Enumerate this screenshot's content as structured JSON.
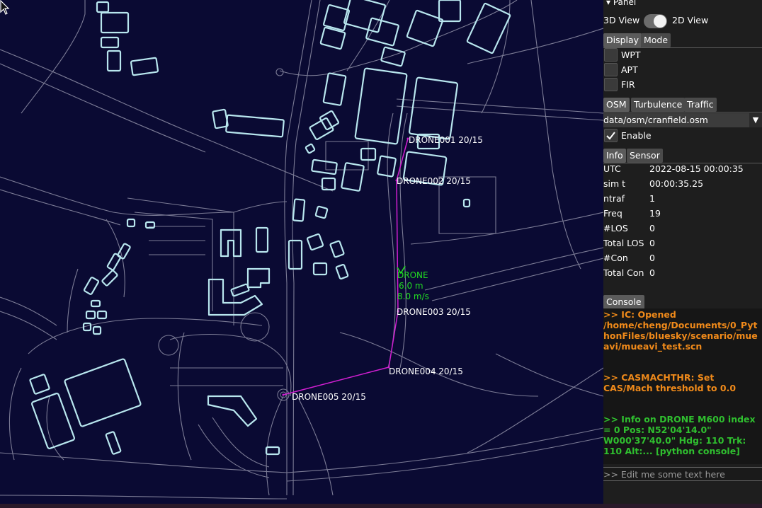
{
  "map": {
    "waypoints": [
      {
        "label": "DRONE001 20/15"
      },
      {
        "label": "DRONE002 20/15"
      },
      {
        "label": "DRONE003 20/15"
      },
      {
        "label": "DRONE004 20/15"
      },
      {
        "label": "DRONE005 20/15"
      }
    ],
    "aircraft": {
      "id": "DRONE",
      "altitude": "6.0 m",
      "speed": "8.0 m/s"
    },
    "colors": {
      "background": "#0a0a33",
      "roads": "#7c7c96",
      "buildings": "#b8e6ee",
      "route": "#d21fd2",
      "aircraft": "#22dd22"
    }
  },
  "panel": {
    "title": "▾ Panel",
    "view_3d_label": "3D View",
    "view_2d_label": "2D View",
    "display_tabs": [
      "Display",
      "Mode"
    ],
    "display_checkboxes": [
      {
        "label": "WPT",
        "checked": false
      },
      {
        "label": "APT",
        "checked": false
      },
      {
        "label": "FIR",
        "checked": false
      }
    ],
    "layer_tabs": [
      "OSM",
      "Turbulence",
      "Traffic"
    ],
    "osm_file": "data/osm/cranfield.osm",
    "enable_label": "Enable",
    "enable_checked": true,
    "info_tabs": [
      "Info",
      "Sensor"
    ],
    "info": [
      {
        "key": "UTC",
        "value": "2022-08-15 00:00:35"
      },
      {
        "key": "sim t",
        "value": "00:00:35.25"
      },
      {
        "key": "ntraf",
        "value": "1"
      },
      {
        "key": "Freq",
        "value": "19"
      },
      {
        "key": "#LOS",
        "value": "0"
      },
      {
        "key": "Total LOS",
        "value": "0"
      },
      {
        "key": "#Con",
        "value": "0"
      },
      {
        "key": "Total Con",
        "value": "0"
      }
    ],
    "console_tab": "Console",
    "console_messages": [
      {
        "text": ">>  IC: Opened /home/cheng/Documents/0_PythonFiles/bluesky/scenario/mueavi/mueavi_test.scn",
        "color": "orange"
      },
      {
        "text": ">>  CASMACHTHR: Set CAS/Mach threshold to 0.0",
        "color": "orange"
      },
      {
        "text": ">>  Info on DRONE M600 index = 0 Pos: N52'04'14.0\"  W000'37'40.0\"  Hdg: 110   Trk: 110  Alt:... [python console]",
        "color": "green"
      }
    ],
    "console_input_placeholder": ">> Edit me some text here"
  }
}
